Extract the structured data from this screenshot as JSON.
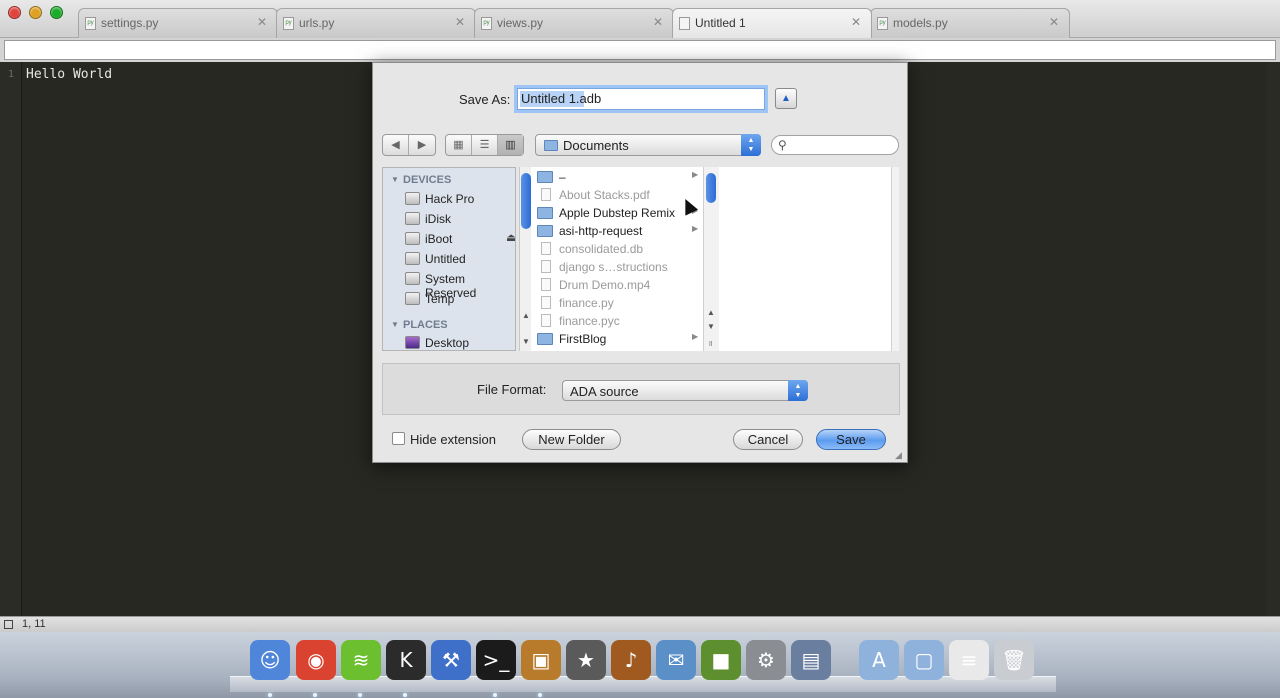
{
  "window": {
    "tabs": [
      {
        "label": "settings.py",
        "icon": "py-file-icon"
      },
      {
        "label": "urls.py",
        "icon": "py-file-icon"
      },
      {
        "label": "views.py",
        "icon": "py-file-icon"
      },
      {
        "label": "Untitled 1",
        "icon": "file-icon"
      },
      {
        "label": "models.py",
        "icon": "py-file-icon"
      }
    ],
    "active_tab": 3,
    "file_icon_text": "py"
  },
  "editor": {
    "line_number": "1",
    "code": "Hello World",
    "status": "1, 11"
  },
  "dialog": {
    "save_as_label": "Save As:",
    "filename": "Untitled 1.adb",
    "location": "Documents",
    "sidebar": {
      "devices_header": "DEVICES",
      "places_header": "PLACES",
      "devices": [
        "Hack Pro",
        "iDisk",
        "iBoot",
        "Untitled",
        "System Reserved",
        "Temp"
      ],
      "places": [
        "Desktop"
      ]
    },
    "files": [
      {
        "name": "–",
        "kind": "folder",
        "arrow": true,
        "dim": false
      },
      {
        "name": "About Stacks.pdf",
        "kind": "doc",
        "arrow": false,
        "dim": true
      },
      {
        "name": "Apple Dubstep Remix",
        "kind": "folder",
        "arrow": true,
        "dim": false
      },
      {
        "name": "asi-http-request",
        "kind": "folder",
        "arrow": true,
        "dim": false
      },
      {
        "name": "consolidated.db",
        "kind": "doc",
        "arrow": false,
        "dim": true
      },
      {
        "name": "django s…structions",
        "kind": "doc",
        "arrow": false,
        "dim": true
      },
      {
        "name": "Drum Demo.mp4",
        "kind": "doc",
        "arrow": false,
        "dim": true
      },
      {
        "name": "finance.py",
        "kind": "doc",
        "arrow": false,
        "dim": true
      },
      {
        "name": "finance.pyc",
        "kind": "doc",
        "arrow": false,
        "dim": true
      },
      {
        "name": "FirstBlog",
        "kind": "folder",
        "arrow": true,
        "dim": false
      }
    ],
    "file_format_label": "File Format:",
    "file_format": "ADA source",
    "hide_extension": "Hide extension",
    "hide_extension_checked": false,
    "new_folder": "New Folder",
    "cancel": "Cancel",
    "save": "Save"
  },
  "dock": {
    "apps": [
      {
        "name": "finder-icon",
        "glyph": "☺",
        "color": "#4f86d9"
      },
      {
        "name": "chrome-icon",
        "glyph": "◉",
        "color": "#d9432f"
      },
      {
        "name": "spotify-icon",
        "glyph": "≋",
        "color": "#6cbf2f"
      },
      {
        "name": "k-app-icon",
        "glyph": "K",
        "color": "#2b2b2b"
      },
      {
        "name": "xcode-icon",
        "glyph": "⚒",
        "color": "#3e6fc9"
      },
      {
        "name": "terminal-icon",
        "glyph": ">_",
        "color": "#1b1b1b"
      },
      {
        "name": "image-capture-icon",
        "glyph": "▣",
        "color": "#b87b2b"
      },
      {
        "name": "imovie-icon",
        "glyph": "★",
        "color": "#5a5a5a"
      },
      {
        "name": "garageband-icon",
        "glyph": "♪",
        "color": "#a05a1f"
      },
      {
        "name": "mail-icon",
        "glyph": "✉",
        "color": "#5a8fc7"
      },
      {
        "name": "minecraft-icon",
        "glyph": "■",
        "color": "#5d8f2f"
      },
      {
        "name": "system-preferences-icon",
        "glyph": "⚙",
        "color": "#8a8d92"
      },
      {
        "name": "preview-icon",
        "glyph": "▤",
        "color": "#6a7fa0"
      },
      {
        "name": "applications-folder-icon",
        "glyph": "A",
        "color": "#8fb2dd"
      },
      {
        "name": "documents-folder-icon",
        "glyph": "▢",
        "color": "#8fb2dd"
      },
      {
        "name": "html-document-icon",
        "glyph": "≡",
        "color": "#e9e9e9"
      },
      {
        "name": "trash-icon",
        "glyph": "🗑",
        "color": "#c9ccd1"
      }
    ]
  }
}
